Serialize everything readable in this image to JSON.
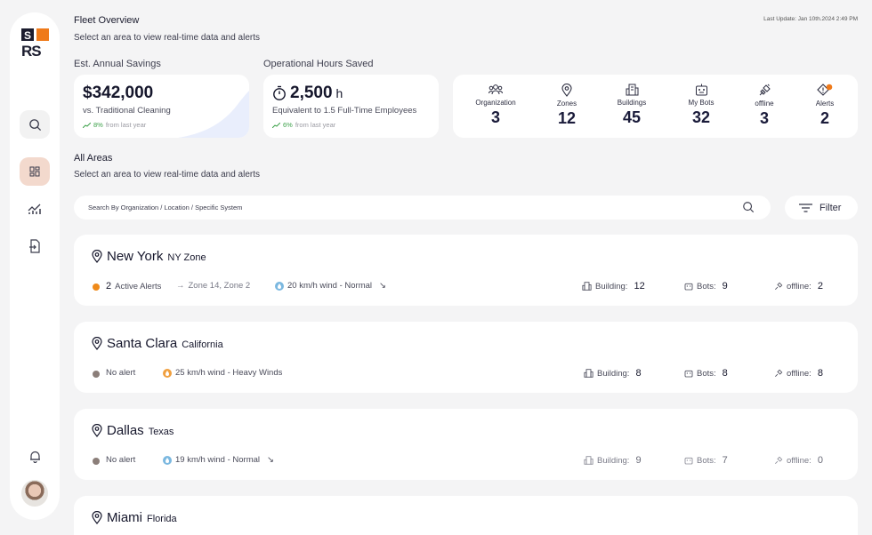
{
  "app": {
    "logo_text": "SRS"
  },
  "header": {
    "title": "Fleet Overview",
    "subtitle": "Select an area to view real-time data and alerts",
    "last_update": "Last Update: Jan 10th.2024 2:49 PM"
  },
  "savings": {
    "section_label": "Est. Annual Savings",
    "value": "$342,000",
    "caption": "vs. Traditional Cleaning",
    "trend_pct": "8%",
    "trend_text": "from last year"
  },
  "hours": {
    "section_label": "Operational Hours Saved",
    "value": "2,500",
    "unit": "h",
    "caption": "Equivalent to 1.5 Full-Time Employees",
    "trend_pct": "6%",
    "trend_text": "from last year"
  },
  "stats": [
    {
      "label": "Organization",
      "value": "3",
      "icon": "people-icon"
    },
    {
      "label": "Zones",
      "value": "12",
      "icon": "location-pin-icon"
    },
    {
      "label": "Buildings",
      "value": "45",
      "icon": "building-icon"
    },
    {
      "label": "My Bots",
      "value": "32",
      "icon": "robot-icon"
    },
    {
      "label": "offline",
      "value": "3",
      "icon": "unplugged-icon"
    },
    {
      "label": "Alerts",
      "value": "2",
      "icon": "alert-icon"
    }
  ],
  "areas_section": {
    "title": "All Areas",
    "subtitle": "Select an area to view real-time data and alerts",
    "search_placeholder": "Search By Organization  / Location / Specific System",
    "filter_label": "Filter"
  },
  "areas": [
    {
      "name": "New York",
      "region": "NY Zone",
      "alert_count": "2",
      "alert_text": "Active Alerts",
      "zones": "Zone 14, Zone 2",
      "wind": "20 km/h wind - Normal",
      "building_label": "Building:",
      "buildings": "12",
      "bots_label": "Bots:",
      "bots": "9",
      "offline_label": "offline:",
      "offline": "2"
    },
    {
      "name": "Santa Clara",
      "region": "California",
      "alert_text": "No alert",
      "wind": "25 km/h wind - Heavy Winds",
      "building_label": "Building:",
      "buildings": "8",
      "bots_label": "Bots:",
      "bots": "8",
      "offline_label": "offline:",
      "offline": "8"
    },
    {
      "name": "Dallas",
      "region": "Texas",
      "alert_text": "No alert",
      "wind": "19 km/h wind - Normal",
      "building_label": "Building:",
      "buildings": "9",
      "bots_label": "Bots:",
      "bots": "7",
      "offline_label": "offline:",
      "offline": "0"
    },
    {
      "name": "Miami",
      "region": "Florida"
    }
  ],
  "colors": {
    "accent": "#ef7a1a",
    "active_nav": "#f3d9cd",
    "trend_green": "#3da14a",
    "no_alert_dot": "#8b7e79",
    "wind_normal": "#7bb8e0",
    "wind_heavy": "#f0a040"
  }
}
